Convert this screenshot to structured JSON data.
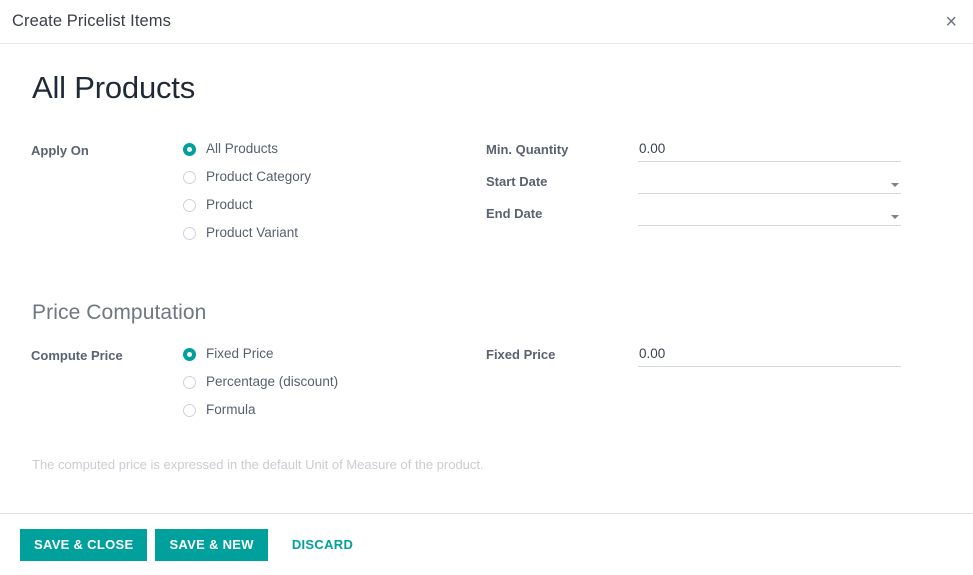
{
  "header": {
    "title": "Create Pricelist Items",
    "close_icon": "close-icon",
    "close_label": "×"
  },
  "record": {
    "title": "All Products"
  },
  "apply_on": {
    "label": "Apply On",
    "options": [
      {
        "label": "All Products",
        "selected": true
      },
      {
        "label": "Product Category",
        "selected": false
      },
      {
        "label": "Product",
        "selected": false
      },
      {
        "label": "Product Variant",
        "selected": false
      }
    ]
  },
  "right_fields": [
    {
      "label": "Min. Quantity",
      "value": "0.00",
      "placeholder": "",
      "has_caret": false
    },
    {
      "label": "Start Date",
      "value": "",
      "placeholder": "",
      "has_caret": true
    },
    {
      "label": "End Date",
      "value": "",
      "placeholder": "",
      "has_caret": true
    }
  ],
  "price_computation": {
    "heading": "Price Computation",
    "compute_price": {
      "label": "Compute Price",
      "options": [
        {
          "label": "Fixed Price",
          "selected": true
        },
        {
          "label": "Percentage (discount)",
          "selected": false
        },
        {
          "label": "Formula",
          "selected": false
        }
      ]
    },
    "fixed_price": {
      "label": "Fixed Price",
      "value": "0.00",
      "placeholder": ""
    },
    "helper_text": "The computed price is expressed in the default Unit of Measure of the product."
  },
  "footer": {
    "save_close_label": "SAVE & CLOSE",
    "save_new_label": "SAVE & NEW",
    "discard_label": "DISCARD"
  },
  "colors": {
    "accent": "#00A09D",
    "title_text": "#3B3E4A",
    "label_text": "#5A6270",
    "muted_text": "#C9CCD1",
    "underline": "#D7D9DD"
  }
}
